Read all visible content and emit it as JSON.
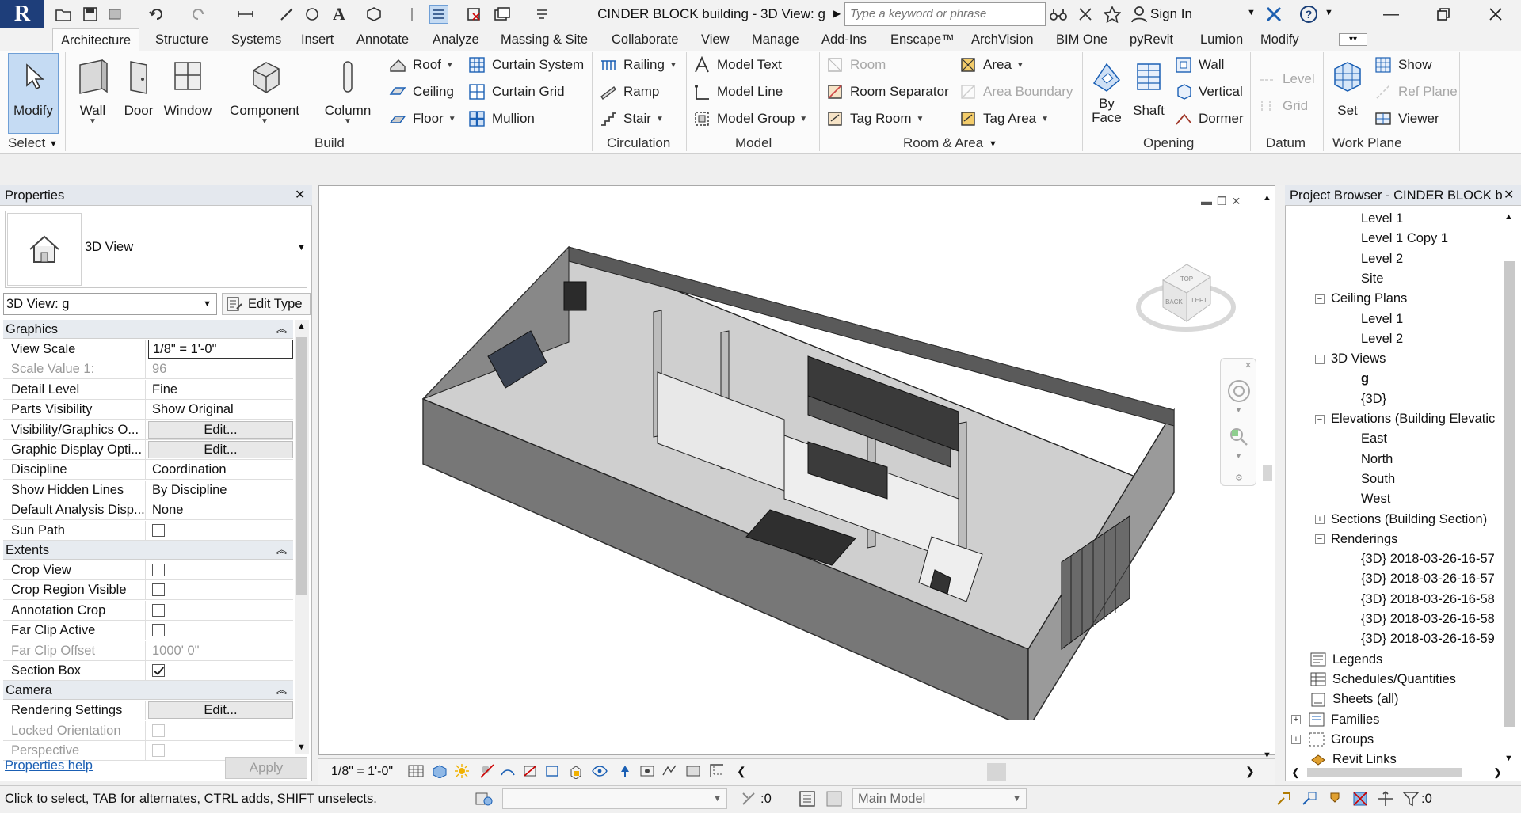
{
  "window": {
    "title": "CINDER BLOCK building - 3D View: g",
    "search_placeholder": "Type a keyword or phrase",
    "sign_in": "Sign In"
  },
  "tabs": [
    "Architecture",
    "Structure",
    "Systems",
    "Insert",
    "Annotate",
    "Analyze",
    "Massing & Site",
    "Collaborate",
    "View",
    "Manage",
    "Add-Ins",
    "Enscape™",
    "ArchVision",
    "BIM One",
    "pyRevit",
    "Lumion",
    "Modify"
  ],
  "ribbon": {
    "select": {
      "modify": "Modify",
      "panel": "Select"
    },
    "build": {
      "wall": "Wall",
      "door": "Door",
      "window": "Window",
      "component": "Component",
      "column": "Column",
      "roof": "Roof",
      "ceiling": "Ceiling",
      "floor": "Floor",
      "curtain_system": "Curtain System",
      "curtain_grid": "Curtain Grid",
      "mullion": "Mullion",
      "panel": "Build"
    },
    "circulation": {
      "railing": "Railing",
      "ramp": "Ramp",
      "stair": "Stair",
      "panel": "Circulation"
    },
    "model": {
      "text": "Model Text",
      "line": "Model Line",
      "group": "Model Group",
      "panel": "Model"
    },
    "room_area": {
      "room": "Room",
      "room_separator": "Room Separator",
      "tag_room": "Tag Room",
      "area": "Area",
      "area_boundary": "Area Boundary",
      "tag_area": "Tag Area",
      "panel": "Room & Area"
    },
    "opening": {
      "by_face_1": "By",
      "by_face_2": "Face",
      "shaft": "Shaft",
      "wall": "Wall",
      "vertical": "Vertical",
      "dormer": "Dormer",
      "panel": "Opening"
    },
    "datum": {
      "level": "Level",
      "grid": "Grid",
      "panel": "Datum"
    },
    "work_plane": {
      "set": "Set",
      "show": "Show",
      "ref_plane": "Ref Plane",
      "viewer": "Viewer",
      "panel": "Work Plane"
    }
  },
  "properties": {
    "title": "Properties",
    "type_name": "3D View",
    "instance_selector": "3D View: g",
    "edit_type": "Edit Type",
    "sections": [
      {
        "name": "Graphics",
        "rows": [
          {
            "name": "View Scale",
            "value": "1/8\" = 1'-0\"",
            "kind": "boxed"
          },
          {
            "name": "Scale Value    1:",
            "value": "96",
            "kind": "disabled"
          },
          {
            "name": "Detail Level",
            "value": "Fine",
            "kind": "text"
          },
          {
            "name": "Parts Visibility",
            "value": "Show Original",
            "kind": "text"
          },
          {
            "name": "Visibility/Graphics O...",
            "value": "Edit...",
            "kind": "button"
          },
          {
            "name": "Graphic Display Opti...",
            "value": "Edit...",
            "kind": "button"
          },
          {
            "name": "Discipline",
            "value": "Coordination",
            "kind": "text"
          },
          {
            "name": "Show Hidden Lines",
            "value": "By Discipline",
            "kind": "text"
          },
          {
            "name": "Default Analysis Disp...",
            "value": "None",
            "kind": "text"
          },
          {
            "name": "Sun Path",
            "value": "",
            "kind": "check",
            "checked": false
          }
        ]
      },
      {
        "name": "Extents",
        "rows": [
          {
            "name": "Crop View",
            "value": "",
            "kind": "check",
            "checked": false
          },
          {
            "name": "Crop Region Visible",
            "value": "",
            "kind": "check",
            "checked": false
          },
          {
            "name": "Annotation Crop",
            "value": "",
            "kind": "check",
            "checked": false
          },
          {
            "name": "Far Clip Active",
            "value": "",
            "kind": "check",
            "checked": false
          },
          {
            "name": "Far Clip Offset",
            "value": "1000'  0\"",
            "kind": "disabled"
          },
          {
            "name": "Section Box",
            "value": "",
            "kind": "check",
            "checked": true
          }
        ]
      },
      {
        "name": "Camera",
        "rows": [
          {
            "name": "Rendering Settings",
            "value": "Edit...",
            "kind": "button"
          },
          {
            "name": "Locked Orientation",
            "value": "",
            "kind": "checkdis",
            "checked": false
          },
          {
            "name": "Perspective",
            "value": "",
            "kind": "checkdis",
            "checked": false
          }
        ]
      }
    ],
    "help_link": "Properties help",
    "apply": "Apply"
  },
  "viewport": {
    "view_cube_top": "TOP",
    "view_cube_front": "BACK",
    "view_cube_side": "LEFT",
    "scale_label": "1/8\" = 1'-0\""
  },
  "browser": {
    "title": "Project Browser - CINDER BLOCK b...",
    "nodes": [
      {
        "label": "Level 1",
        "depth": 2,
        "exp": "",
        "icon": ""
      },
      {
        "label": "Level 1 Copy 1",
        "depth": 2,
        "exp": "",
        "icon": ""
      },
      {
        "label": "Level 2",
        "depth": 2,
        "exp": "",
        "icon": ""
      },
      {
        "label": "Site",
        "depth": 2,
        "exp": "",
        "icon": ""
      },
      {
        "label": "Ceiling Plans",
        "depth": 1,
        "exp": "−",
        "icon": ""
      },
      {
        "label": "Level 1",
        "depth": 2,
        "exp": "",
        "icon": ""
      },
      {
        "label": "Level 2",
        "depth": 2,
        "exp": "",
        "icon": ""
      },
      {
        "label": "3D Views",
        "depth": 1,
        "exp": "−",
        "icon": ""
      },
      {
        "label": "g",
        "depth": 2,
        "exp": "",
        "icon": "",
        "bold": true
      },
      {
        "label": "{3D}",
        "depth": 2,
        "exp": "",
        "icon": ""
      },
      {
        "label": "Elevations (Building Elevatic",
        "depth": 1,
        "exp": "−",
        "icon": ""
      },
      {
        "label": "East",
        "depth": 2,
        "exp": "",
        "icon": ""
      },
      {
        "label": "North",
        "depth": 2,
        "exp": "",
        "icon": ""
      },
      {
        "label": "South",
        "depth": 2,
        "exp": "",
        "icon": ""
      },
      {
        "label": "West",
        "depth": 2,
        "exp": "",
        "icon": ""
      },
      {
        "label": "Sections (Building Section)",
        "depth": 1,
        "exp": "+",
        "icon": ""
      },
      {
        "label": "Renderings",
        "depth": 1,
        "exp": "−",
        "icon": ""
      },
      {
        "label": "{3D} 2018-03-26-16-57",
        "depth": 2,
        "exp": "",
        "icon": ""
      },
      {
        "label": "{3D} 2018-03-26-16-57",
        "depth": 2,
        "exp": "",
        "icon": ""
      },
      {
        "label": "{3D} 2018-03-26-16-58",
        "depth": 2,
        "exp": "",
        "icon": ""
      },
      {
        "label": "{3D} 2018-03-26-16-58",
        "depth": 2,
        "exp": "",
        "icon": ""
      },
      {
        "label": "{3D} 2018-03-26-16-59",
        "depth": 2,
        "exp": "",
        "icon": ""
      },
      {
        "label": "Legends",
        "depth": 0,
        "exp": "",
        "icon": "legend"
      },
      {
        "label": "Schedules/Quantities",
        "depth": 0,
        "exp": "",
        "icon": "schedule"
      },
      {
        "label": "Sheets (all)",
        "depth": 0,
        "exp": "",
        "icon": "sheet"
      },
      {
        "label": "Families",
        "depth": 0,
        "exp": "+",
        "icon": "family"
      },
      {
        "label": "Groups",
        "depth": 0,
        "exp": "+",
        "icon": "group"
      },
      {
        "label": "Revit Links",
        "depth": 0,
        "exp": "",
        "icon": "link"
      }
    ]
  },
  "status": {
    "hint": "Click to select, TAB for alternates, CTRL adds, SHIFT unselects.",
    "count": ":0",
    "model": "Main Model",
    "filter_count": ":0"
  }
}
